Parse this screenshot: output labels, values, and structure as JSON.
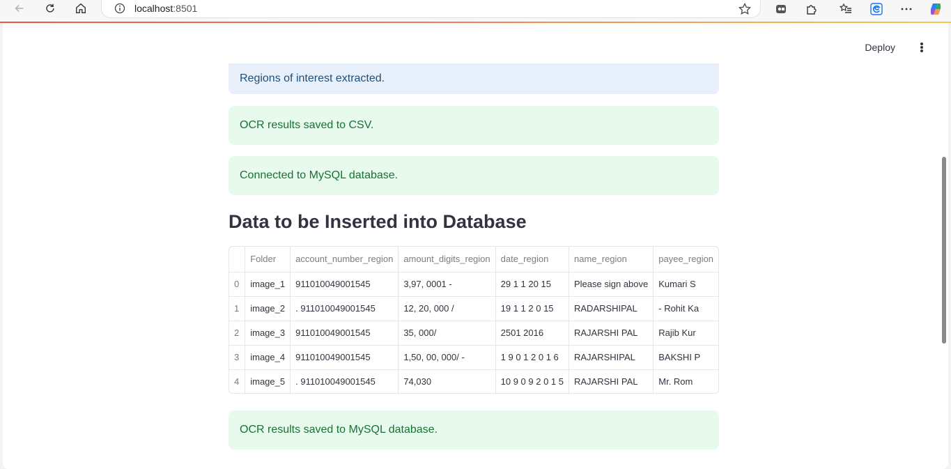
{
  "browser": {
    "url_host": "localhost",
    "url_port": ":8501"
  },
  "app": {
    "deploy_label": "Deploy"
  },
  "alerts": {
    "roi": "Regions of interest extracted.",
    "csv": "OCR results saved to CSV.",
    "mysql_connected": "Connected to MySQL database.",
    "mysql_saved": "OCR results saved to MySQL database."
  },
  "heading": "Data to be Inserted into Database",
  "table": {
    "columns": [
      "",
      "Folder",
      "account_number_region",
      "amount_digits_region",
      "date_region",
      "name_region",
      "payee_region"
    ],
    "rows": [
      [
        "0",
        "image_1",
        "911010049001545",
        "3,97, 0001 -",
        "29 1 1 20 15",
        "Please sign above",
        "Kumari S"
      ],
      [
        "1",
        "image_2",
        ". 911010049001545",
        "12, 20, 000 /",
        "19 1 1 2 0 15",
        "RADARSHIPAL",
        "- Rohit Ka"
      ],
      [
        "2",
        "image_3",
        "911010049001545",
        "35, 000/",
        "2501 2016",
        "RAJARSHI PAL",
        "Rajib Kur"
      ],
      [
        "3",
        "image_4",
        "911010049001545",
        "1,50, 00, 000/ -",
        "1 9 0 1 2 0 1 6",
        "RAJARSHIPAL",
        "BAKSHI P"
      ],
      [
        "4",
        "image_5",
        ". 911010049001545",
        "74,030",
        "10 9 0 9 2 0 1 5",
        "RAJARSHI PAL",
        "Mr. Rom"
      ]
    ]
  }
}
